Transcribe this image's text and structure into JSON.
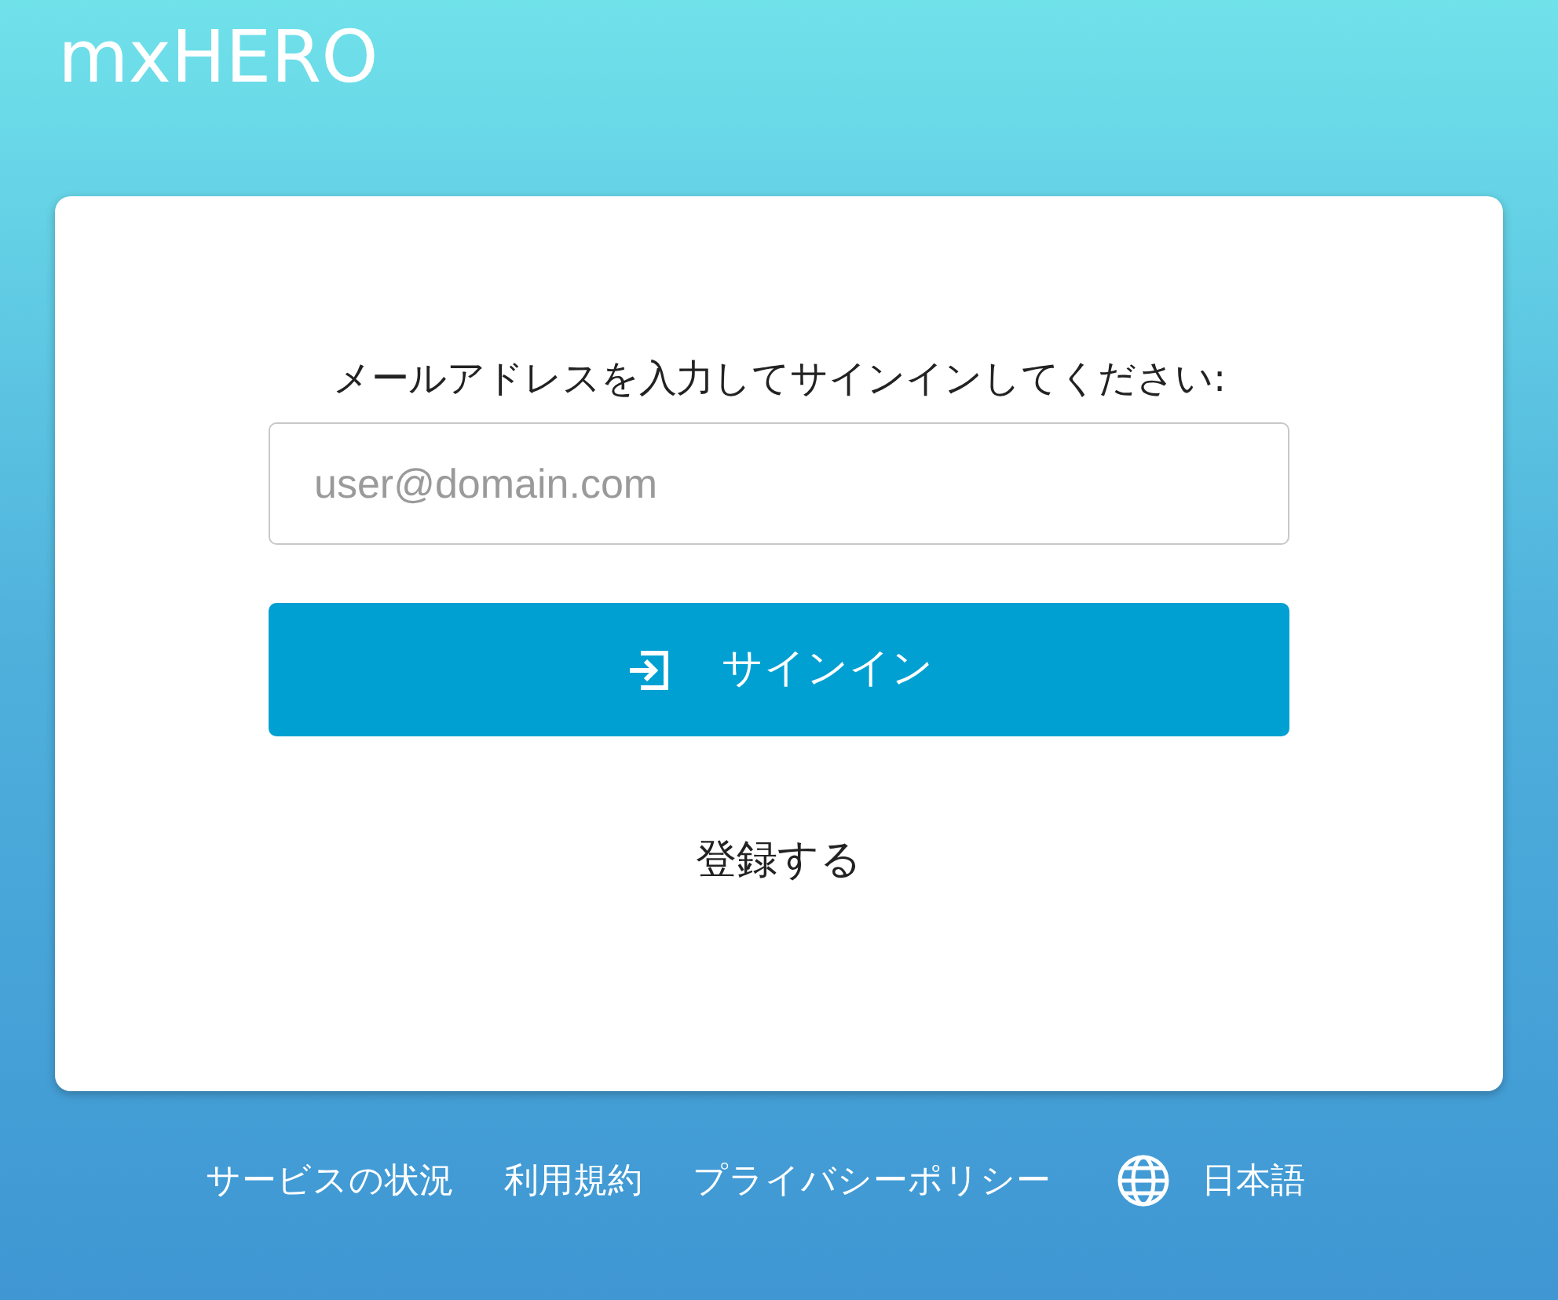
{
  "logo": "mxHERO",
  "form": {
    "prompt": "メールアドレスを入力してサインインしてください:",
    "email_field": {
      "placeholder": "user@domain.com"
    },
    "signin_button": "サインイン",
    "register_link": "登録する"
  },
  "footer": {
    "links": [
      "サービスの状況",
      "利用規約",
      "プライバシーポリシー"
    ],
    "language": "日本語"
  }
}
